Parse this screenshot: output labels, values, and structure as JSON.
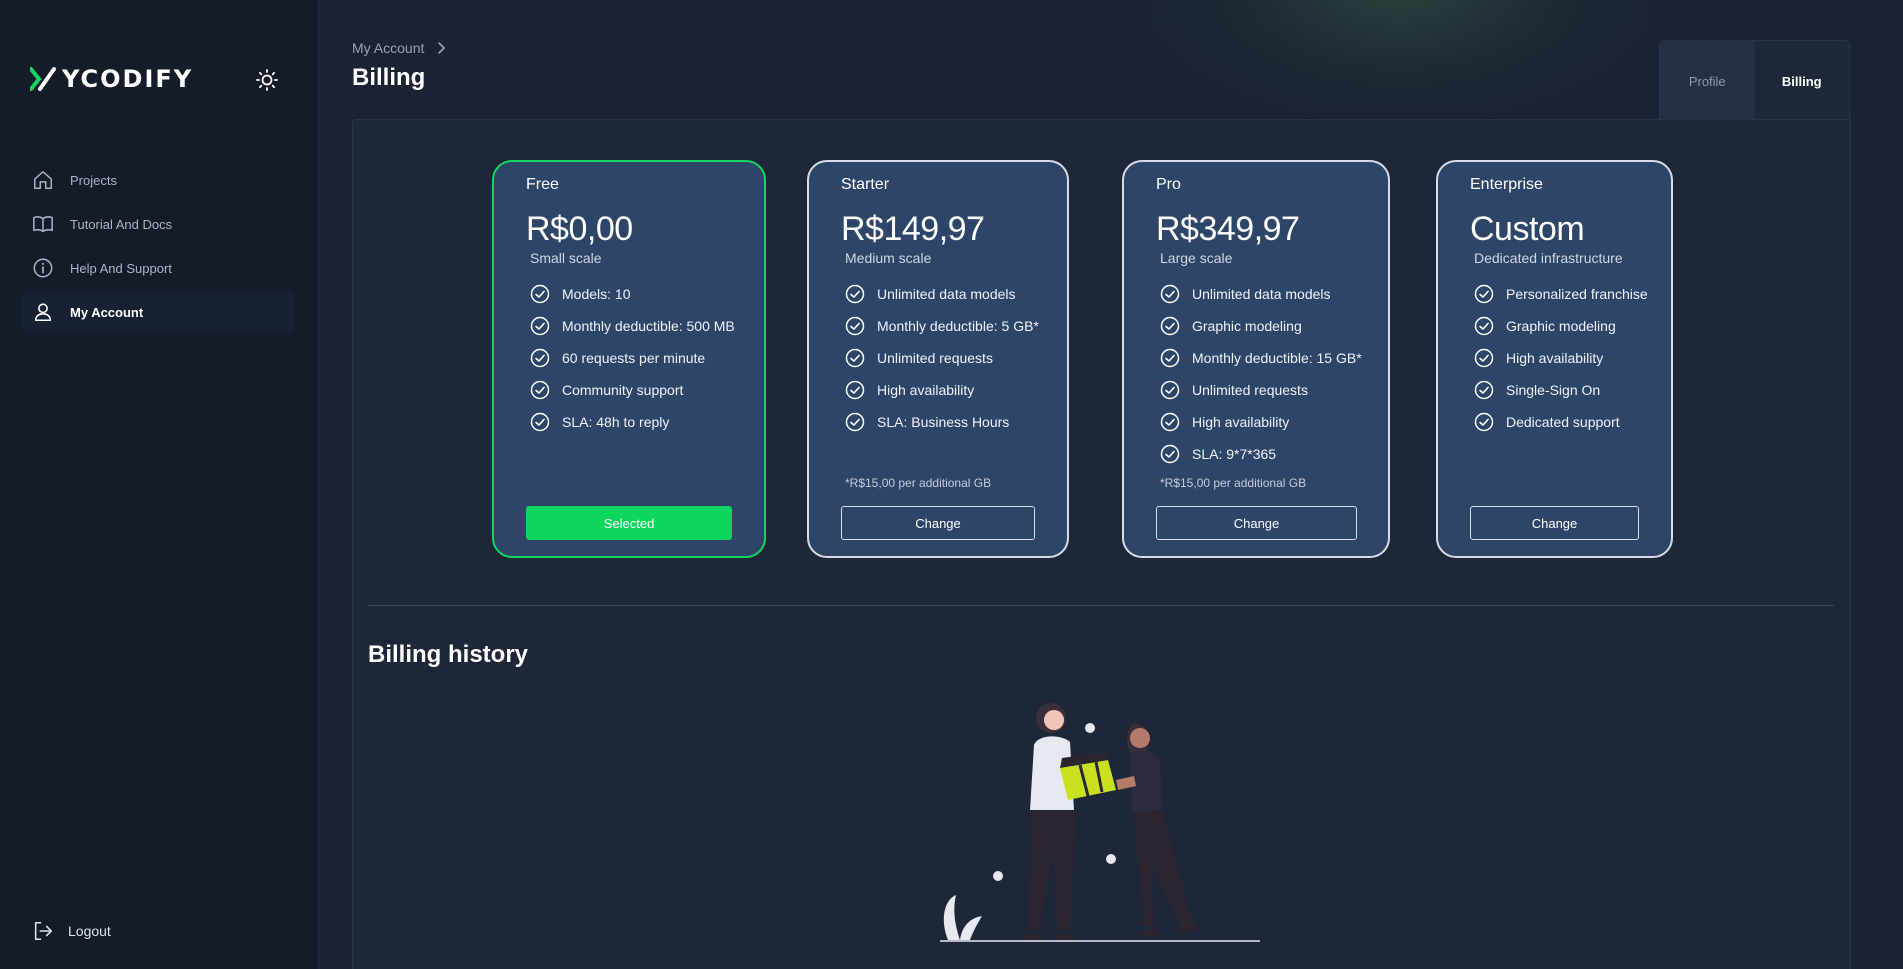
{
  "brand": {
    "name": "YCODIFY",
    "accent": "#11d660"
  },
  "sidebar": {
    "items": [
      {
        "label": "Projects",
        "icon": "home-icon",
        "active": false
      },
      {
        "label": "Tutorial And Docs",
        "icon": "book-icon",
        "active": false
      },
      {
        "label": "Help And Support",
        "icon": "info-icon",
        "active": false
      },
      {
        "label": "My Account",
        "icon": "user-icon",
        "active": true
      }
    ],
    "logout_label": "Logout"
  },
  "header": {
    "breadcrumb": "My Account",
    "title": "Billing",
    "tabs": [
      {
        "label": "Profile",
        "active": false
      },
      {
        "label": "Billing",
        "active": true
      }
    ]
  },
  "plans": [
    {
      "name": "Free",
      "price": "R$0,00",
      "scale": "Small scale",
      "features": [
        "Models: 10",
        "Monthly deductible: 500 MB",
        "60 requests per minute",
        "Community support",
        "SLA: 48h to reply"
      ],
      "note": "",
      "button": "Selected",
      "selected": true
    },
    {
      "name": "Starter",
      "price": "R$149,97",
      "scale": "Medium scale",
      "features": [
        "Unlimited data models",
        "Monthly deductible: 5 GB*",
        "Unlimited requests",
        "High availability",
        "SLA: Business Hours"
      ],
      "note": "*R$15,00 per additional GB",
      "button": "Change",
      "selected": false
    },
    {
      "name": "Pro",
      "price": "R$349,97",
      "scale": "Large scale",
      "features": [
        "Unlimited data models",
        "Graphic modeling",
        "Monthly deductible: 15 GB*",
        "Unlimited requests",
        "High availability",
        "SLA: 9*7*365"
      ],
      "note": "*R$15,00 per additional GB",
      "button": "Change",
      "selected": false
    },
    {
      "name": "Enterprise",
      "price": "Custom",
      "scale": "Dedicated infrastructure",
      "features": [
        "Personalized franchise",
        "Graphic modeling",
        "High availability",
        "Single-Sign On",
        "Dedicated support"
      ],
      "note": "",
      "button": "Change",
      "selected": false
    }
  ],
  "billing_history": {
    "title": "Billing history"
  }
}
